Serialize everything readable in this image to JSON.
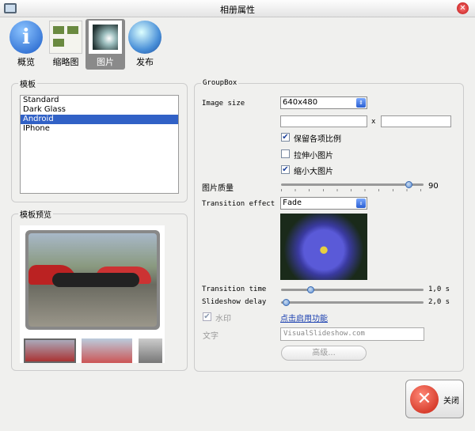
{
  "window": {
    "title": "相册属性",
    "icon": "app-icon",
    "close": "close-window-icon"
  },
  "toolbar": [
    {
      "label": "概览",
      "icon": "info-icon"
    },
    {
      "label": "缩略图",
      "icon": "thumbnails-icon"
    },
    {
      "label": "图片",
      "icon": "picture-icon",
      "selected": true
    },
    {
      "label": "发布",
      "icon": "globe-icon"
    }
  ],
  "template": {
    "legend": "模板",
    "items": [
      "Standard",
      "Dark Glass",
      "Android",
      "IPhone"
    ],
    "selected": "Android"
  },
  "preview": {
    "legend": "模板预览"
  },
  "group": {
    "legend": "GroupBox",
    "image_size_label": "Image size",
    "image_size_value": "640x480",
    "width_value": "",
    "height_value": "",
    "x_sep": "x",
    "keep_ratio": {
      "label": "保留各项比例",
      "checked": true
    },
    "stretch_small": {
      "label": "拉伸小图片",
      "checked": false
    },
    "shrink_large": {
      "label": "缩小大图片",
      "checked": true
    },
    "quality": {
      "label": "图片质量",
      "value": 90,
      "display": "90"
    },
    "transition_effect_label": "Transition effect",
    "transition_effect_value": "Fade",
    "transition_time": {
      "label": "Transition time",
      "display": "1,0 s",
      "value": 1.0
    },
    "slideshow_delay": {
      "label": "Slideshow delay",
      "display": "2,0 s",
      "value": 2.0
    },
    "watermark": {
      "label": "水印",
      "checked": true,
      "disabled": true
    },
    "enable_link": "点击启用功能",
    "text_label": "文字",
    "text_value": "VisualSlideshow.com",
    "advanced_button": "高级..."
  },
  "close_button": "关闭",
  "colors": {
    "accent": "#3161c6",
    "link": "#1a3fb0",
    "close": "#d8321c"
  }
}
